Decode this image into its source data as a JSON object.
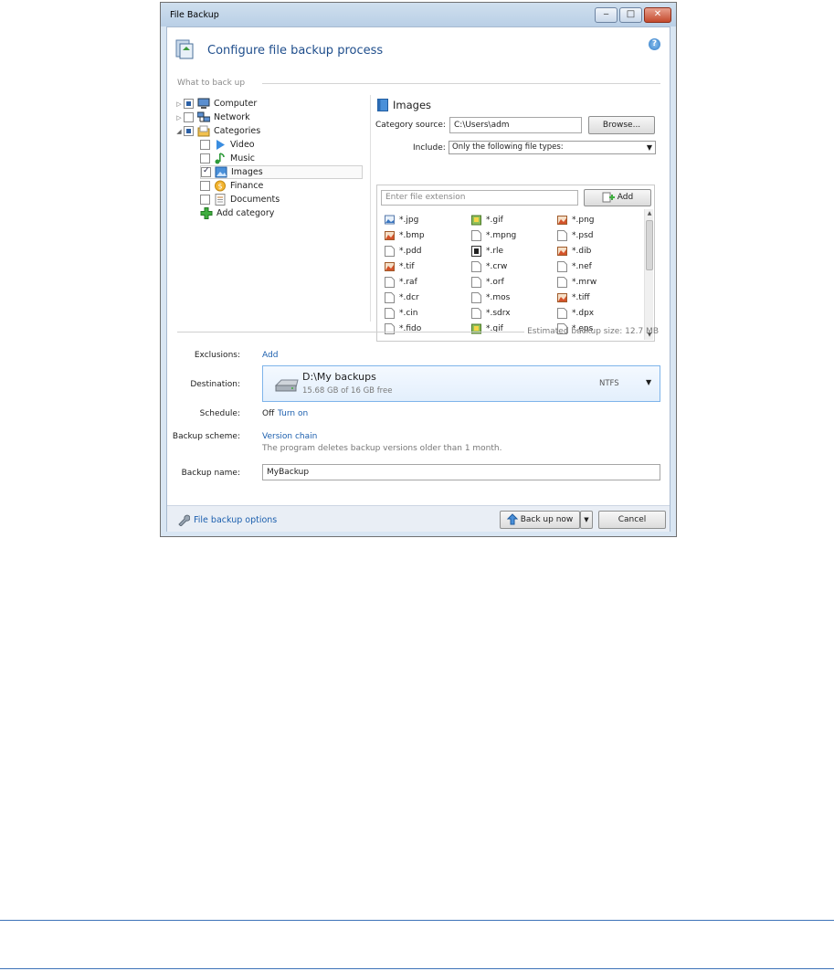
{
  "window": {
    "title": "File Backup",
    "controls": {
      "minimize": "‒",
      "maximize": "□",
      "close": "✕"
    }
  },
  "header": {
    "title": "Configure file backup process",
    "help": "?"
  },
  "what_to_back_up": {
    "label": "What to back up",
    "tree": [
      {
        "label": "Computer",
        "icon": "computer-icon",
        "state": "partial",
        "level": 0,
        "expander": "▷"
      },
      {
        "label": "Network",
        "icon": "network-icon",
        "state": "unchecked",
        "level": 0,
        "expander": "▷"
      },
      {
        "label": "Categories",
        "icon": "folder-icon",
        "state": "partial",
        "level": 0,
        "expander": "◢"
      },
      {
        "label": "Video",
        "icon": "video-icon",
        "state": "unchecked",
        "level": 1
      },
      {
        "label": "Music",
        "icon": "music-icon",
        "state": "unchecked",
        "level": 1
      },
      {
        "label": "Images",
        "icon": "images-icon",
        "state": "checked",
        "level": 1,
        "selected": true
      },
      {
        "label": "Finance",
        "icon": "finance-icon",
        "state": "unchecked",
        "level": 1
      },
      {
        "label": "Documents",
        "icon": "documents-icon",
        "state": "unchecked",
        "level": 1
      },
      {
        "label": "Add category",
        "icon": "add-icon",
        "level": 1,
        "action": true
      }
    ]
  },
  "category_panel": {
    "title": "Images",
    "source_label": "Category source:",
    "source_value": "C:\\Users\\adm",
    "browse": "Browse...",
    "include_label": "Include:",
    "include_value": "Only the following file types:",
    "extension_placeholder": "Enter file extension",
    "add": "Add",
    "extensions": [
      [
        "*.jpg",
        "*.gif",
        "*.png"
      ],
      [
        "*.bmp",
        "*.mpng",
        "*.psd"
      ],
      [
        "*.pdd",
        "*.rle",
        "*.dib"
      ],
      [
        "*.tif",
        "*.crw",
        "*.nef"
      ],
      [
        "*.raf",
        "*.orf",
        "*.mrw"
      ],
      [
        "*.dcr",
        "*.mos",
        "*.tiff"
      ],
      [
        "*.cin",
        "*.sdrx",
        "*.dpx"
      ],
      [
        "*.fido",
        "*.gif",
        "*.eps"
      ]
    ]
  },
  "estimated": "Estimated backup size: 12.7 MB",
  "settings": {
    "exclusions_label": "Exclusions:",
    "exclusions_link": "Add",
    "destination_label": "Destination:",
    "destination_name": "D:\\My backups",
    "destination_free": "15.68 GB of 16 GB free",
    "destination_fs": "NTFS",
    "schedule_label": "Schedule:",
    "schedule_value": "Off",
    "schedule_link": "Turn on",
    "scheme_label": "Backup scheme:",
    "scheme_link": "Version chain",
    "scheme_desc": "The program deletes backup versions older than 1 month.",
    "name_label": "Backup name:",
    "name_value": "MyBackup"
  },
  "footer": {
    "options_link": "File backup options",
    "backup_now": "Back up now",
    "cancel": "Cancel"
  },
  "colors": {
    "link": "#1c5fae",
    "title": "#1f4e8c",
    "page_rule": "#3d73b8"
  }
}
